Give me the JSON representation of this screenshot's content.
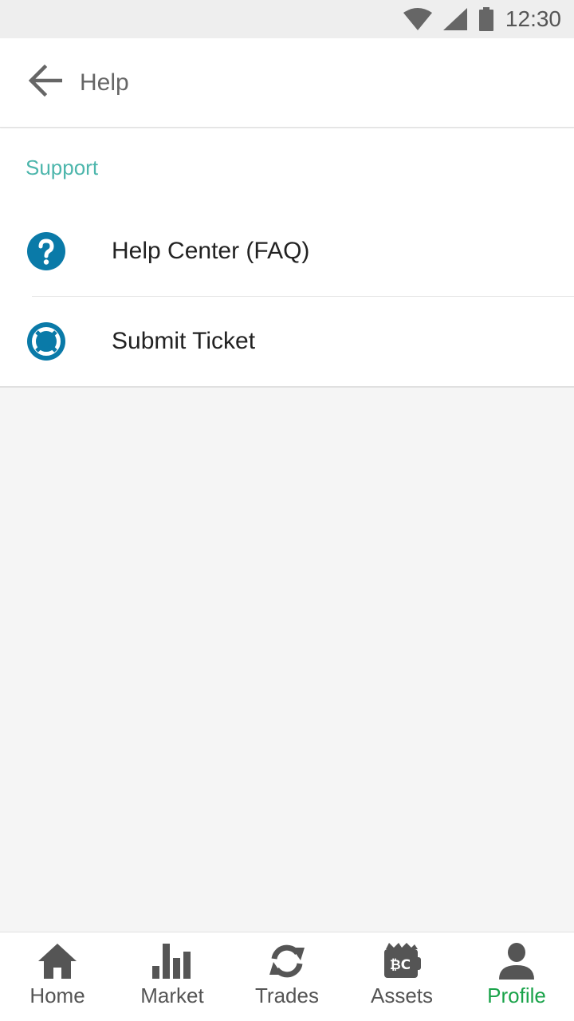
{
  "status_bar": {
    "time": "12:30"
  },
  "app_bar": {
    "title": "Help"
  },
  "support": {
    "header": "Support",
    "items": [
      {
        "label": "Help Center (FAQ)",
        "icon": "question-circle-icon"
      },
      {
        "label": "Submit Ticket",
        "icon": "lifebuoy-icon"
      }
    ]
  },
  "bottom_nav": {
    "items": [
      {
        "label": "Home",
        "icon": "home-icon"
      },
      {
        "label": "Market",
        "icon": "bar-chart-icon"
      },
      {
        "label": "Trades",
        "icon": "sync-icon"
      },
      {
        "label": "Assets",
        "icon": "wallet-icon"
      },
      {
        "label": "Profile",
        "icon": "person-icon"
      }
    ],
    "active": "Profile"
  },
  "colors": {
    "accent_teal": "#4db6ac",
    "icon_blue": "#0a7aa8",
    "active_green": "#1aa34a",
    "nav_gray": "#555555"
  }
}
